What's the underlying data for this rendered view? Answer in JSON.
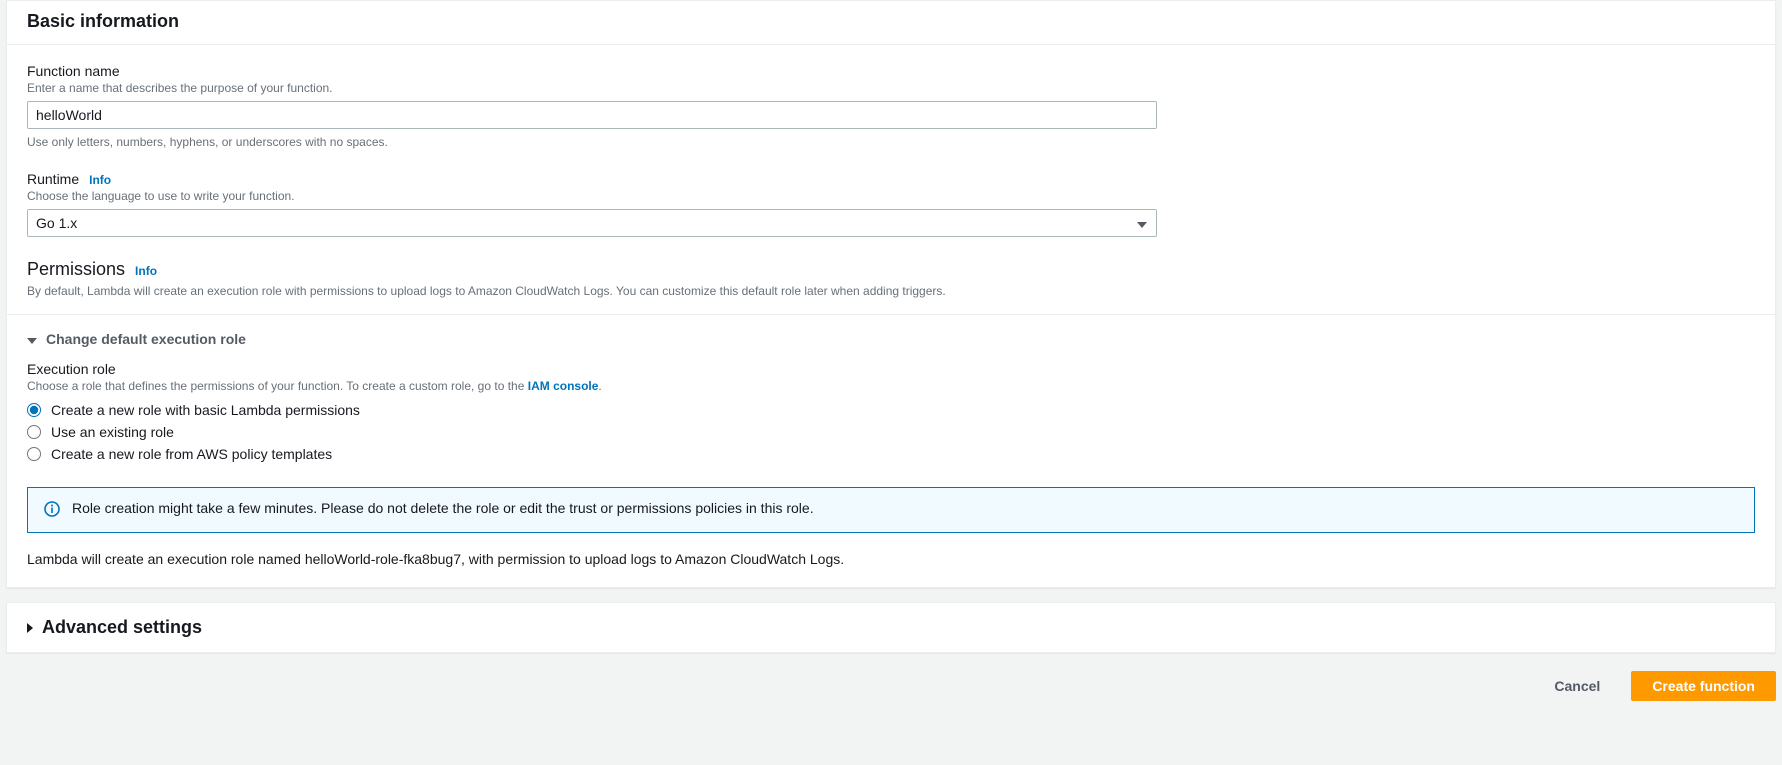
{
  "basic": {
    "title": "Basic information",
    "function_name": {
      "label": "Function name",
      "hint": "Enter a name that describes the purpose of your function.",
      "value": "helloWorld",
      "constraint": "Use only letters, numbers, hyphens, or underscores with no spaces."
    },
    "runtime": {
      "label": "Runtime",
      "info": "Info",
      "hint": "Choose the language to use to write your function.",
      "value": "Go 1.x"
    },
    "permissions": {
      "label": "Permissions",
      "info": "Info",
      "hint": "By default, Lambda will create an execution role with permissions to upload logs to Amazon CloudWatch Logs. You can customize this default role later when adding triggers."
    },
    "exec_role": {
      "expander": "Change default execution role",
      "label": "Execution role",
      "hint_prefix": "Choose a role that defines the permissions of your function. To create a custom role, go to the ",
      "iam_link": "IAM console",
      "hint_suffix": ".",
      "options": [
        "Create a new role with basic Lambda permissions",
        "Use an existing role",
        "Create a new role from AWS policy templates"
      ],
      "info_box": "Role creation might take a few minutes. Please do not delete the role or edit the trust or permissions policies in this role.",
      "summary": "Lambda will create an execution role named helloWorld-role-fka8bug7, with permission to upload logs to Amazon CloudWatch Logs."
    }
  },
  "advanced": {
    "title": "Advanced settings"
  },
  "footer": {
    "cancel": "Cancel",
    "create": "Create function"
  }
}
